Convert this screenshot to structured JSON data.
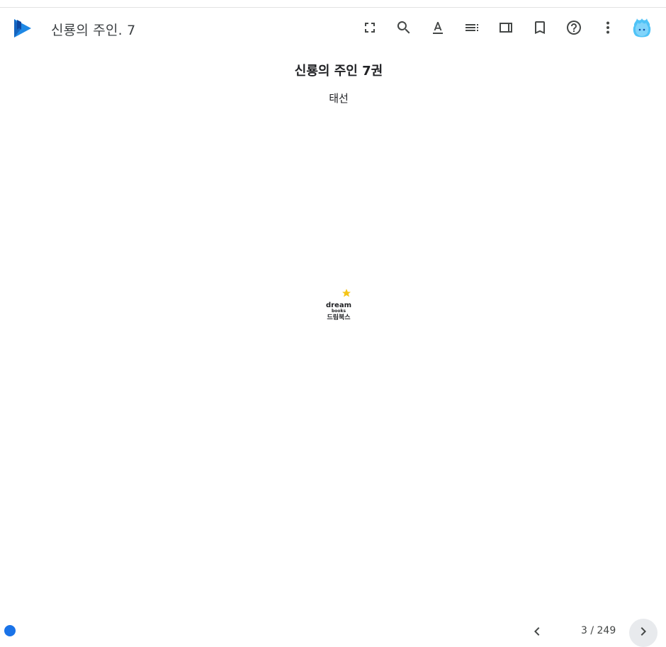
{
  "app": {
    "name_icon": "google-play-books-logo-icon"
  },
  "header": {
    "book_title": "신룡의 주인. 7",
    "toolbar": [
      {
        "name": "fullscreen",
        "icon": "fullscreen-icon"
      },
      {
        "name": "search",
        "icon": "search-icon"
      },
      {
        "name": "display-options",
        "icon": "text-format-icon"
      },
      {
        "name": "contents",
        "icon": "table-of-contents-icon"
      },
      {
        "name": "side-panel",
        "icon": "side-panel-icon"
      },
      {
        "name": "bookmark",
        "icon": "bookmark-icon"
      },
      {
        "name": "help",
        "icon": "help-icon"
      },
      {
        "name": "more-options",
        "icon": "more-vert-icon"
      }
    ],
    "avatar_icon": "user-avatar-icon"
  },
  "page": {
    "title": "신룡의 주인 7권",
    "author": "태선",
    "publisher_logo": {
      "icon": "dreambooks-logo-icon",
      "text_line1": "dream",
      "text_line2": "books",
      "text_line3": "드림북스",
      "star_color": "#f5c518"
    }
  },
  "footer": {
    "page_indicator": "3 / 249",
    "progress_color": "#1a73e8"
  }
}
